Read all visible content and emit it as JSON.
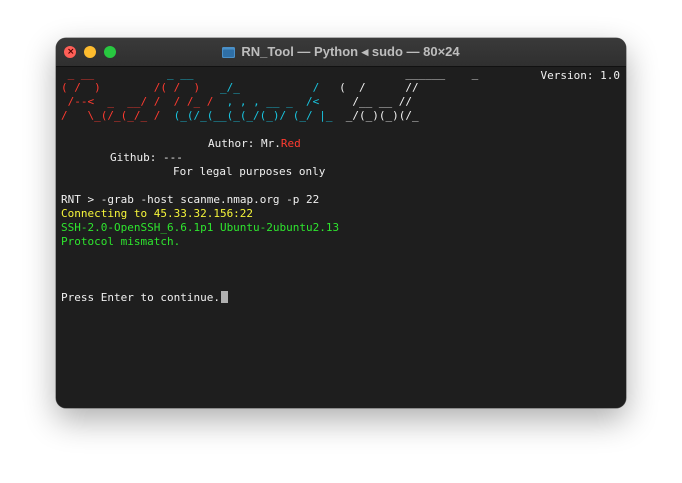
{
  "window": {
    "title": "RN_Tool — Python ◂ sudo — 80×24"
  },
  "banner": {
    "version": "Version: 1.0",
    "art_lines": [
      [
        " _ __           ",
        "_ __",
        "                ",
        "______    _"
      ],
      [
        "( /  )        /( /  )   _/_           /   (  /      //"
      ],
      [
        " /--<  _  __/ /  / /_ /  , , , __ _  /<     /__ __ //"
      ],
      [
        "/   \\_(/_(_/_ /  (_(/_(__(_(_/(_)/ (_/ |_  _/(_)(_)(/_"
      ]
    ],
    "art_row0_red": " _ __",
    "art_row0_cyan": "           _ __",
    "art_row0_white": "                                ______    _",
    "art_row1_red": "( /  )        /( /  )",
    "art_row1_cyan": "   _/_           /",
    "art_row1_white": "   (  /      //",
    "art_row2_red": " /--<  _  __/ /  / /_ /",
    "art_row2_cyan": "  , , , __ _  /<",
    "art_row2_white": "     /__ __ //",
    "art_row3_red": "/   \\_(/_(_/_ /",
    "art_row3_cyan": "  (_(/_(__(_(_/(_)/ (_/ |_",
    "art_row3_white": "  _/(_)(_)(/_",
    "author_label": "Author: Mr.",
    "author_name": "Red",
    "github": "Github: ---",
    "legal": "For legal purposes only"
  },
  "session": {
    "prompt": "RNT > ",
    "command": "-grab -host scanme.nmap.org -p 22",
    "connecting": "Connecting to 45.33.32.156:22",
    "ssh_banner": "SSH-2.0-OpenSSH_6.6.1p1 Ubuntu-2ubuntu2.13",
    "status": "Protocol mismatch.",
    "continue_prompt": "Press Enter to continue."
  },
  "colors": {
    "red": "#ff3b30",
    "cyan": "#19c5e0",
    "yellow": "#f5f53a",
    "green": "#2ee52e"
  }
}
